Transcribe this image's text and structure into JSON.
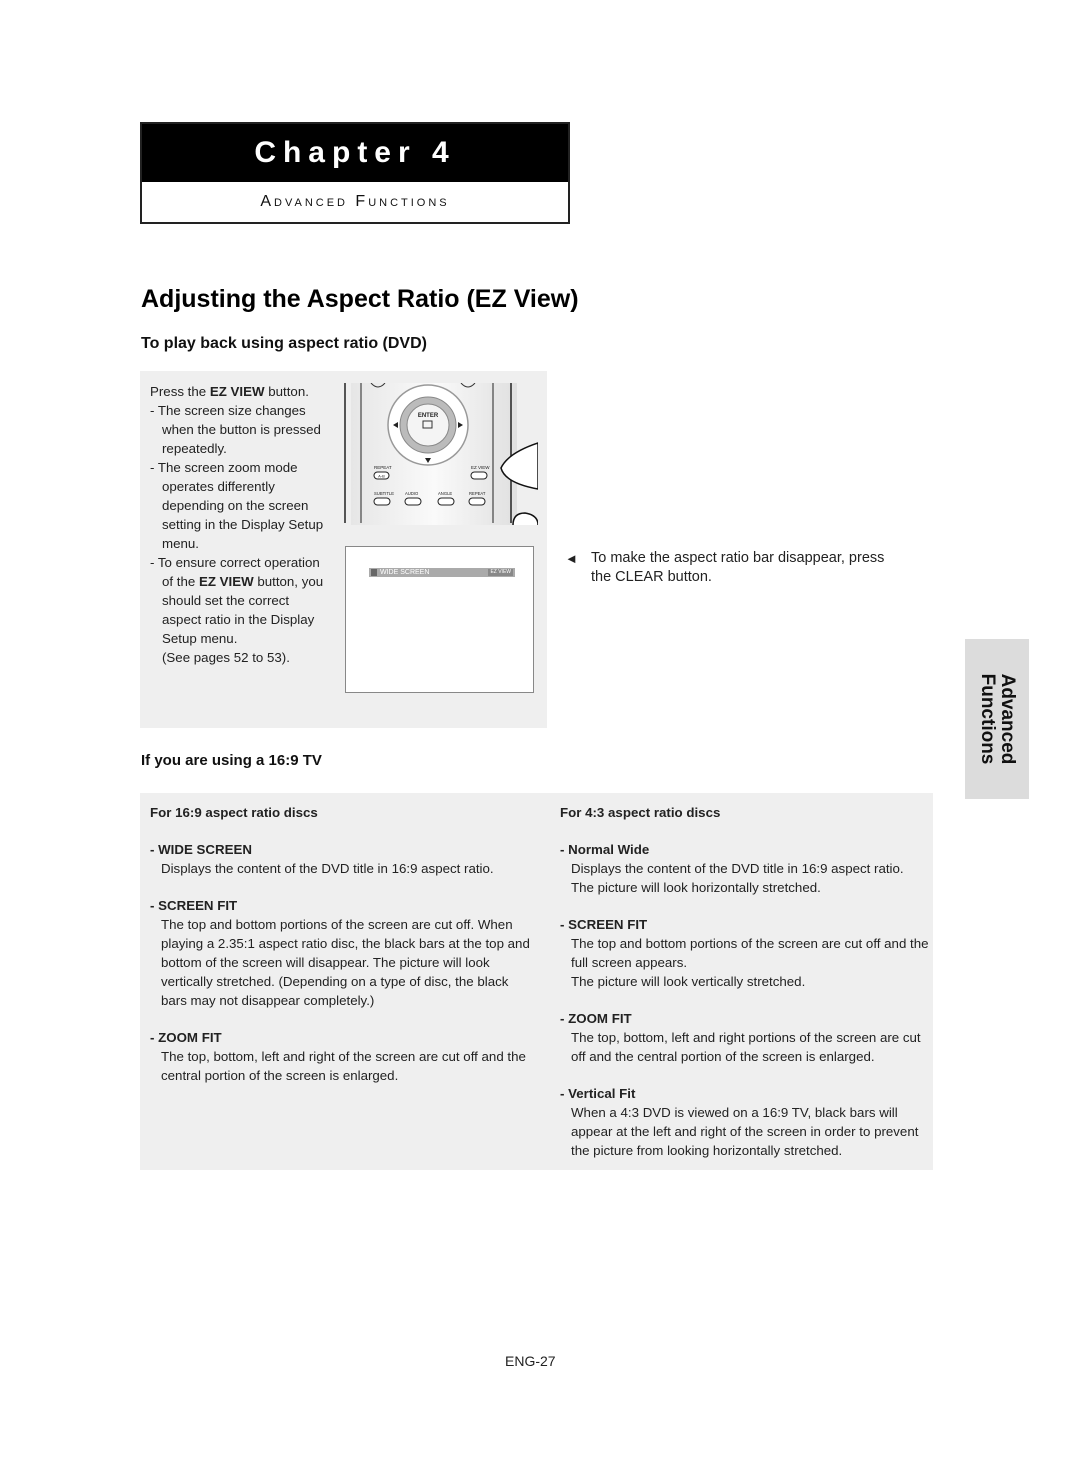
{
  "chapter": {
    "title": "Chapter 4",
    "subtitle": "Advanced Functions"
  },
  "page_title": "Adjusting the Aspect Ratio (EZ View)",
  "section_dvd": {
    "heading": "To play back using aspect ratio (DVD)",
    "step_prefix": "Press the ",
    "step_key": "EZ VIEW",
    "step_suffix": " button.",
    "notes": [
      "- The screen size changes when the button is pressed repeatedly.",
      "- The screen zoom mode operates differently depending on the screen setting in the Display Setup menu."
    ],
    "note3_prefix": "- To ensure correct operation of the ",
    "note3_key": "EZ VIEW",
    "note3_suffix": " button, you should set the correct aspect ratio in the Display Setup menu.",
    "note3_ref": "(See pages 52 to 53).",
    "remote": {
      "enter_label": "ENTER",
      "repeat_ab_label": "REPEAT",
      "ab_label": "A-B",
      "ez_view_label": "EZ VIEW",
      "buttons": [
        "SUBTITLE",
        "AUDIO",
        "ANGLE",
        "REPEAT"
      ]
    },
    "osd": {
      "label": "WIDE SCREEN",
      "badge": "EZ VIEW"
    },
    "clear_note": "To make the aspect ratio bar disappear, press the CLEAR button.",
    "clear_arrow": "◄"
  },
  "side_tab": {
    "line1": "Advanced",
    "line2": "Functions"
  },
  "section_169": {
    "heading": "If you are using a 16:9 TV",
    "left": {
      "head": "For 16:9 aspect ratio discs",
      "items": [
        {
          "title": "- WIDE SCREEN",
          "desc": "Displays the content of the DVD title in 16:9 aspect ratio."
        },
        {
          "title": "- SCREEN FIT",
          "desc": "The top and bottom portions of the screen are cut off. When playing a 2.35:1 aspect ratio disc, the black bars at the top and bottom of the screen will disappear. The picture will look vertically stretched. (Depending on a type of disc, the black bars may not disappear completely.)"
        },
        {
          "title": "- ZOOM FIT",
          "desc": "The top, bottom, left and right of the screen are cut off and the central portion of the screen is enlarged."
        }
      ]
    },
    "right": {
      "head": "For 4:3 aspect ratio discs",
      "items": [
        {
          "title": "- Normal Wide",
          "desc": "Displays the content of the DVD title in 16:9 aspect ratio.",
          "desc2": "The picture will look horizontally stretched."
        },
        {
          "title": "- SCREEN FIT",
          "desc": "The top and bottom portions of the screen are cut off and the full screen appears.",
          "desc2": "The picture will look vertically stretched."
        },
        {
          "title": "- ZOOM FIT",
          "desc": "The top, bottom, left and right portions of the screen are cut off and the central portion of the screen is enlarged."
        },
        {
          "title": "- Vertical Fit",
          "desc": "When a 4:3 DVD is viewed on a 16:9 TV, black bars will appear at the left and right of the screen in order to prevent the picture from looking horizontally stretched."
        }
      ]
    }
  },
  "page_number": "ENG-27"
}
